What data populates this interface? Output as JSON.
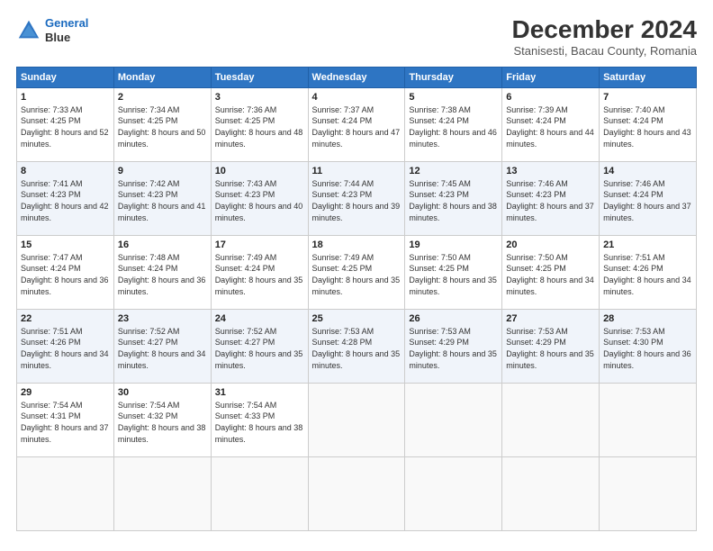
{
  "header": {
    "logo_line1": "General",
    "logo_line2": "Blue",
    "title": "December 2024",
    "subtitle": "Stanisesti, Bacau County, Romania"
  },
  "calendar": {
    "headers": [
      "Sunday",
      "Monday",
      "Tuesday",
      "Wednesday",
      "Thursday",
      "Friday",
      "Saturday"
    ],
    "weeks": [
      [
        null,
        null,
        null,
        null,
        null,
        null,
        null
      ]
    ],
    "days": [
      {
        "date": 1,
        "dow": 0,
        "sunrise": "7:33 AM",
        "sunset": "4:25 PM",
        "daylight": "8 hours and 52 minutes."
      },
      {
        "date": 2,
        "dow": 1,
        "sunrise": "7:34 AM",
        "sunset": "4:25 PM",
        "daylight": "8 hours and 50 minutes."
      },
      {
        "date": 3,
        "dow": 2,
        "sunrise": "7:36 AM",
        "sunset": "4:25 PM",
        "daylight": "8 hours and 48 minutes."
      },
      {
        "date": 4,
        "dow": 3,
        "sunrise": "7:37 AM",
        "sunset": "4:24 PM",
        "daylight": "8 hours and 47 minutes."
      },
      {
        "date": 5,
        "dow": 4,
        "sunrise": "7:38 AM",
        "sunset": "4:24 PM",
        "daylight": "8 hours and 46 minutes."
      },
      {
        "date": 6,
        "dow": 5,
        "sunrise": "7:39 AM",
        "sunset": "4:24 PM",
        "daylight": "8 hours and 44 minutes."
      },
      {
        "date": 7,
        "dow": 6,
        "sunrise": "7:40 AM",
        "sunset": "4:24 PM",
        "daylight": "8 hours and 43 minutes."
      },
      {
        "date": 8,
        "dow": 0,
        "sunrise": "7:41 AM",
        "sunset": "4:23 PM",
        "daylight": "8 hours and 42 minutes."
      },
      {
        "date": 9,
        "dow": 1,
        "sunrise": "7:42 AM",
        "sunset": "4:23 PM",
        "daylight": "8 hours and 41 minutes."
      },
      {
        "date": 10,
        "dow": 2,
        "sunrise": "7:43 AM",
        "sunset": "4:23 PM",
        "daylight": "8 hours and 40 minutes."
      },
      {
        "date": 11,
        "dow": 3,
        "sunrise": "7:44 AM",
        "sunset": "4:23 PM",
        "daylight": "8 hours and 39 minutes."
      },
      {
        "date": 12,
        "dow": 4,
        "sunrise": "7:45 AM",
        "sunset": "4:23 PM",
        "daylight": "8 hours and 38 minutes."
      },
      {
        "date": 13,
        "dow": 5,
        "sunrise": "7:46 AM",
        "sunset": "4:23 PM",
        "daylight": "8 hours and 37 minutes."
      },
      {
        "date": 14,
        "dow": 6,
        "sunrise": "7:46 AM",
        "sunset": "4:24 PM",
        "daylight": "8 hours and 37 minutes."
      },
      {
        "date": 15,
        "dow": 0,
        "sunrise": "7:47 AM",
        "sunset": "4:24 PM",
        "daylight": "8 hours and 36 minutes."
      },
      {
        "date": 16,
        "dow": 1,
        "sunrise": "7:48 AM",
        "sunset": "4:24 PM",
        "daylight": "8 hours and 36 minutes."
      },
      {
        "date": 17,
        "dow": 2,
        "sunrise": "7:49 AM",
        "sunset": "4:24 PM",
        "daylight": "8 hours and 35 minutes."
      },
      {
        "date": 18,
        "dow": 3,
        "sunrise": "7:49 AM",
        "sunset": "4:25 PM",
        "daylight": "8 hours and 35 minutes."
      },
      {
        "date": 19,
        "dow": 4,
        "sunrise": "7:50 AM",
        "sunset": "4:25 PM",
        "daylight": "8 hours and 35 minutes."
      },
      {
        "date": 20,
        "dow": 5,
        "sunrise": "7:50 AM",
        "sunset": "4:25 PM",
        "daylight": "8 hours and 34 minutes."
      },
      {
        "date": 21,
        "dow": 6,
        "sunrise": "7:51 AM",
        "sunset": "4:26 PM",
        "daylight": "8 hours and 34 minutes."
      },
      {
        "date": 22,
        "dow": 0,
        "sunrise": "7:51 AM",
        "sunset": "4:26 PM",
        "daylight": "8 hours and 34 minutes."
      },
      {
        "date": 23,
        "dow": 1,
        "sunrise": "7:52 AM",
        "sunset": "4:27 PM",
        "daylight": "8 hours and 34 minutes."
      },
      {
        "date": 24,
        "dow": 2,
        "sunrise": "7:52 AM",
        "sunset": "4:27 PM",
        "daylight": "8 hours and 35 minutes."
      },
      {
        "date": 25,
        "dow": 3,
        "sunrise": "7:53 AM",
        "sunset": "4:28 PM",
        "daylight": "8 hours and 35 minutes."
      },
      {
        "date": 26,
        "dow": 4,
        "sunrise": "7:53 AM",
        "sunset": "4:29 PM",
        "daylight": "8 hours and 35 minutes."
      },
      {
        "date": 27,
        "dow": 5,
        "sunrise": "7:53 AM",
        "sunset": "4:29 PM",
        "daylight": "8 hours and 35 minutes."
      },
      {
        "date": 28,
        "dow": 6,
        "sunrise": "7:53 AM",
        "sunset": "4:30 PM",
        "daylight": "8 hours and 36 minutes."
      },
      {
        "date": 29,
        "dow": 0,
        "sunrise": "7:54 AM",
        "sunset": "4:31 PM",
        "daylight": "8 hours and 37 minutes."
      },
      {
        "date": 30,
        "dow": 1,
        "sunrise": "7:54 AM",
        "sunset": "4:32 PM",
        "daylight": "8 hours and 38 minutes."
      },
      {
        "date": 31,
        "dow": 2,
        "sunrise": "7:54 AM",
        "sunset": "4:33 PM",
        "daylight": "8 hours and 38 minutes."
      }
    ]
  }
}
